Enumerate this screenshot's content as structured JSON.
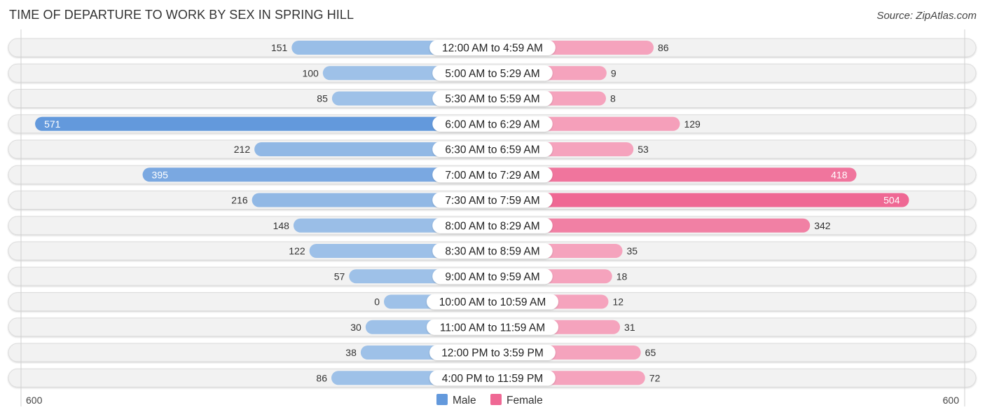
{
  "title": "TIME OF DEPARTURE TO WORK BY SEX IN SPRING HILL",
  "source": "Source: ZipAtlas.com",
  "colors": {
    "male_light": "#9ec1e8",
    "male_dark": "#6399dc",
    "female_light": "#f5a3bd",
    "female_dark": "#ef6894",
    "track": "#f2f2f2"
  },
  "chart_data": {
    "type": "bar",
    "orientation": "horizontal-diverging",
    "title": "TIME OF DEPARTURE TO WORK BY SEX IN SPRING HILL",
    "categories": [
      "12:00 AM to 4:59 AM",
      "5:00 AM to 5:29 AM",
      "5:30 AM to 5:59 AM",
      "6:00 AM to 6:29 AM",
      "6:30 AM to 6:59 AM",
      "7:00 AM to 7:29 AM",
      "7:30 AM to 7:59 AM",
      "8:00 AM to 8:29 AM",
      "8:30 AM to 8:59 AM",
      "9:00 AM to 9:59 AM",
      "10:00 AM to 10:59 AM",
      "11:00 AM to 11:59 AM",
      "12:00 PM to 3:59 PM",
      "4:00 PM to 11:59 PM"
    ],
    "series": [
      {
        "name": "Male",
        "values": [
          151,
          100,
          85,
          571,
          212,
          395,
          216,
          148,
          122,
          57,
          0,
          30,
          38,
          86
        ]
      },
      {
        "name": "Female",
        "values": [
          86,
          9,
          8,
          129,
          53,
          418,
          504,
          342,
          35,
          18,
          12,
          31,
          65,
          72
        ]
      }
    ],
    "axis": {
      "left_label": "600",
      "right_label": "600",
      "range": [
        0,
        600
      ]
    },
    "legend": {
      "items": [
        "Male",
        "Female"
      ],
      "position": "bottom-center"
    }
  }
}
